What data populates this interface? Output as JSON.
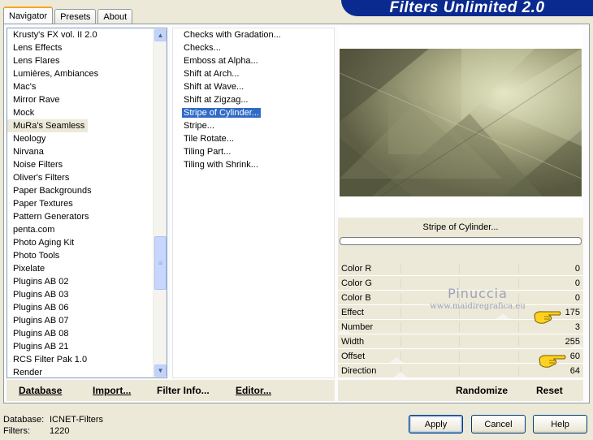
{
  "tabs": [
    "Navigator",
    "Presets",
    "About"
  ],
  "active_tab": "Navigator",
  "title": "Filters Unlimited 2.0",
  "categories": {
    "items": [
      "Krusty's FX vol. II 2.0",
      "Lens Effects",
      "Lens Flares",
      "Lumières, Ambiances",
      "Mac's",
      "Mirror Rave",
      "Mock",
      "MuRa's Seamless",
      "Neology",
      "Nirvana",
      "Noise Filters",
      "Oliver's Filters",
      "Paper Backgrounds",
      "Paper Textures",
      "Pattern Generators",
      "penta.com",
      "Photo Aging Kit",
      "Photo Tools",
      "Pixelate",
      "Plugins AB 02",
      "Plugins AB 03",
      "Plugins AB 06",
      "Plugins AB 07",
      "Plugins AB 08",
      "Plugins AB 21",
      "RCS Filter Pak 1.0",
      "Render"
    ],
    "selected": "MuRa's Seamless"
  },
  "filters": {
    "items": [
      "Checks with Gradation...",
      "Checks...",
      "Emboss at Alpha...",
      "Shift at Arch...",
      "Shift at Wave...",
      "Shift at Zigzag...",
      "Stripe of Cylinder...",
      "Stripe...",
      "Tile Rotate...",
      "Tiling Part...",
      "Tiling with Shrink..."
    ],
    "selected": "Stripe of Cylinder..."
  },
  "selected_filter_name": "Stripe of Cylinder...",
  "params": [
    {
      "name": "Color R",
      "value": "0",
      "level": 0
    },
    {
      "name": "Color G",
      "value": "0",
      "level": 0
    },
    {
      "name": "Color B",
      "value": "0",
      "level": 0
    },
    {
      "name": "Effect",
      "value": "175",
      "level": 175
    },
    {
      "name": "Number",
      "value": "3",
      "level": 3
    },
    {
      "name": "Width",
      "value": "255",
      "level": 255
    },
    {
      "name": "Offset",
      "value": "60",
      "level": 60
    },
    {
      "name": "Direction",
      "value": "64",
      "level": 64
    }
  ],
  "watermark": {
    "name": "Pinuccia",
    "url": "www.maidiregrafica.eu"
  },
  "toolbar": {
    "database": "Database",
    "import": "Import...",
    "filter_info": "Filter Info...",
    "editor": "Editor...",
    "randomize": "Randomize",
    "reset": "Reset"
  },
  "status": {
    "database_label": "Database:",
    "database_value": "ICNET-Filters",
    "filters_label": "Filters:",
    "filters_value": "1220"
  },
  "buttons": {
    "apply": "Apply",
    "cancel": "Cancel",
    "help": "Help"
  },
  "colors": {
    "selection": "#316ac5",
    "banner": "#0b2a8f",
    "dialog_bg": "#ece9d8",
    "preview_tone": "#9a9a76"
  },
  "icons": {
    "scroll_up": "up-arrow-icon",
    "scroll_down": "down-arrow-icon",
    "pointer": "pointing-hand-icon"
  }
}
